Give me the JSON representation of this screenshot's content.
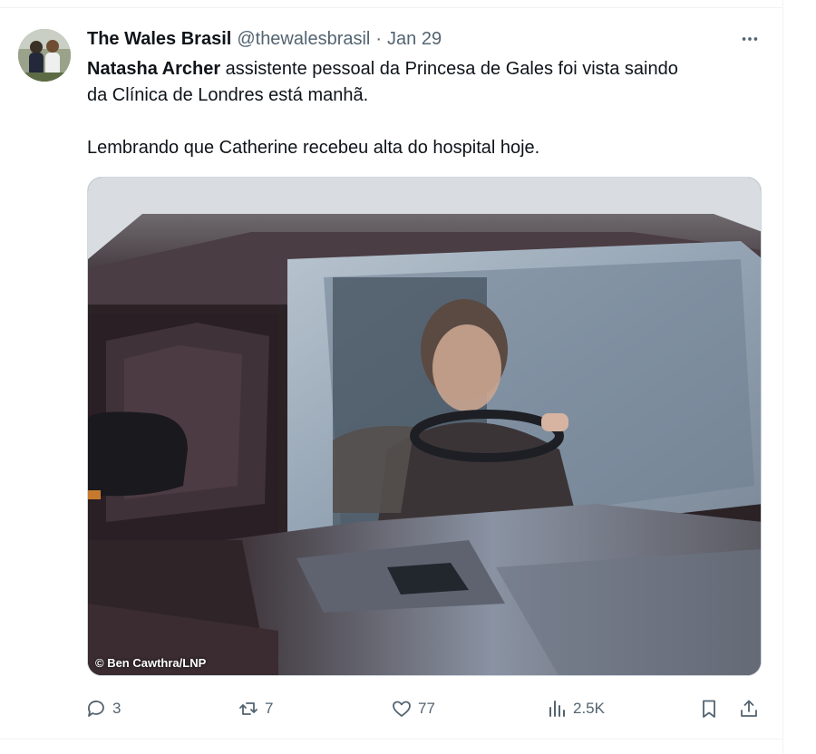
{
  "tweet": {
    "author_name": "The Wales Brasil",
    "handle": "@thewalesbrasil",
    "separator": "·",
    "date": "Jan 29",
    "text": {
      "bold_name": "Natasha Archer",
      "line1_rest": " assistente pessoal da Princesa de Gales foi vista saindo",
      "line2": "da Clínica de Londres está manhã.",
      "line3": "Lembrando que Catherine recebeu alta do hospital hoje."
    },
    "media": {
      "credit": "© Ben Cawthra/LNP"
    },
    "actions": {
      "replies": "3",
      "reposts": "7",
      "likes": "77",
      "views": "2.5K"
    }
  },
  "icons": [
    "more-icon",
    "reply-icon",
    "repost-icon",
    "like-icon",
    "views-icon",
    "bookmark-icon",
    "share-icon"
  ]
}
